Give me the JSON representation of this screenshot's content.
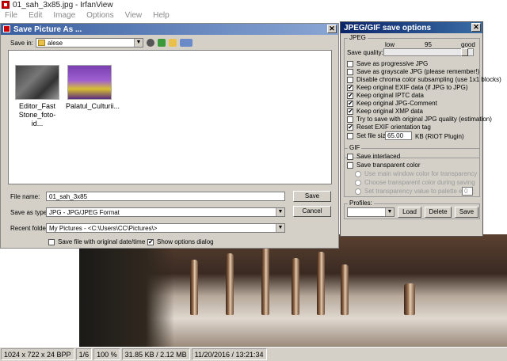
{
  "main": {
    "title": "01_sah_3x85.jpg - IrfanView",
    "menu": [
      "File",
      "Edit",
      "Image",
      "Options",
      "View",
      "Help"
    ]
  },
  "statusbar": {
    "dimensions": "1024 x 722 x 24 BPP",
    "index": "1/6",
    "zoom": "100 %",
    "size": "31.85 KB / 2.12 MB",
    "datetime": "11/20/2016 / 13:21:34"
  },
  "save_dialog": {
    "title": "Save Picture As ...",
    "save_in_label": "Save in:",
    "save_in_value": "alese",
    "files": [
      {
        "caption_line1": "Editor_Fast",
        "caption_line2": "Stone_foto-id..."
      },
      {
        "caption_line1": "Palatul_Culturii...",
        "caption_line2": ""
      }
    ],
    "file_name_label": "File name:",
    "file_name_value": "01_sah_3x85",
    "save_as_type_label": "Save as type:",
    "save_as_type_value": "JPG - JPG/JPEG Format",
    "recent_folders_label": "Recent folders:",
    "recent_folders_value": "My Pictures  -  <C:\\Users\\CC\\Pictures\\>",
    "save_button": "Save",
    "cancel_button": "Cancel",
    "keep_date_label": "Save file with original date/time",
    "keep_date_checked": false,
    "show_options_label": "Show options dialog",
    "show_options_checked": true
  },
  "jpeg_dialog": {
    "title": "JPEG/GIF save options",
    "jpeg_group": "JPEG",
    "quality_label": "Save quality:",
    "quality_low": "low",
    "quality_value": "95",
    "quality_high": "good",
    "quality_level": 95,
    "options": [
      {
        "label": "Save as progressive JPG",
        "checked": false
      },
      {
        "label": "Save as grayscale JPG (please remember!)",
        "checked": false
      },
      {
        "label": "Disable chroma color subsampling (use 1x1 blocks)",
        "checked": false
      },
      {
        "label": "Keep original EXIF data (if JPG to JPG)",
        "checked": true
      },
      {
        "label": "Keep original IPTC data",
        "checked": true
      },
      {
        "label": "Keep original JPG-Comment",
        "checked": true
      },
      {
        "label": "Keep original XMP data",
        "checked": true
      },
      {
        "label": "Try to save with original JPG quality (estimation)",
        "checked": false
      },
      {
        "label": "Reset EXIF orientation tag",
        "checked": true
      }
    ],
    "file_size_label": "Set file size:",
    "file_size_value": "65.00",
    "file_size_unit": "KB (RIOT Plugin)",
    "gif_group": "GIF",
    "gif_interlaced": "Save interlaced",
    "gif_transparent": "Save transparent color",
    "gif_radio_1": "Use main window color for transparency",
    "gif_radio_2": "Choose transparent color during saving",
    "gif_radio_3": "Set transparency value to palette entry:",
    "gif_palette_entry": "0",
    "profiles_label": "Profiles:",
    "load_button": "Load",
    "delete_button": "Delete",
    "save_button": "Save"
  }
}
